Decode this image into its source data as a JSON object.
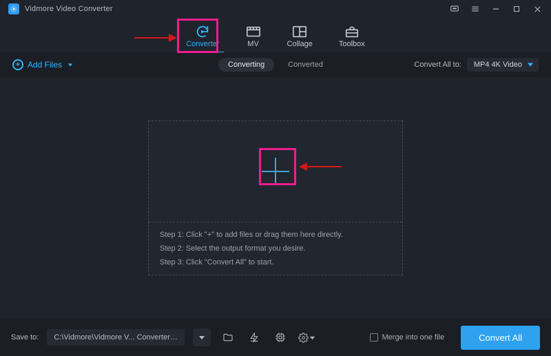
{
  "title": "Vidmore Video Converter",
  "tabs": {
    "converter": "Converter",
    "mv": "MV",
    "collage": "Collage",
    "toolbox": "Toolbox"
  },
  "toolbar": {
    "add_files": "Add Files",
    "converting": "Converting",
    "converted": "Converted",
    "convert_all_to_label": "Convert All to:",
    "format_selected": "MP4 4K Video"
  },
  "steps": {
    "s1": "Step 1: Click \"+\" to add files or drag them here directly.",
    "s2": "Step 2: Select the output format you desire.",
    "s3": "Step 3: Click \"Convert All\" to start."
  },
  "bottom": {
    "save_to_label": "Save to:",
    "path": "C:\\Vidmore\\Vidmore V... Converter\\Converted",
    "merge_label": "Merge into one file",
    "convert_all": "Convert All"
  }
}
